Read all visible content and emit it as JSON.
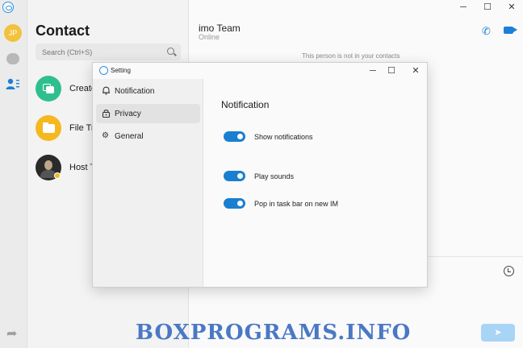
{
  "rail": {
    "avatar_initials": "JP"
  },
  "contacts": {
    "title": "Contact",
    "search_placeholder": "Search (Ctrl+S)",
    "items": [
      {
        "label": "Create",
        "color": "#2fbf8f"
      },
      {
        "label": "File Tr",
        "color": "#f5b820"
      },
      {
        "label": "Host T",
        "color": "#2a2a2a"
      }
    ]
  },
  "chat": {
    "name": "imo Team",
    "status": "Online",
    "notice": "This person is not in your contacts",
    "send_label": "➤"
  },
  "window": {
    "minimize": "─",
    "maximize": "☐",
    "close": "✕"
  },
  "dialog": {
    "title": "Setting",
    "nav": [
      {
        "label": "Notification",
        "icon": "bell-icon"
      },
      {
        "label": "Privacy",
        "icon": "lock-icon",
        "selected": true
      },
      {
        "label": "General",
        "icon": "gear-icon"
      }
    ],
    "heading": "Notification",
    "toggles": [
      {
        "label": "Show notifications",
        "on": true
      },
      {
        "label": "Play sounds",
        "on": true
      },
      {
        "label": "Pop in task bar on new IM",
        "on": true
      }
    ]
  },
  "watermark": "BOXPROGRAMS.INFO",
  "colors": {
    "accent": "#1a7fd0",
    "call_icons": "#1d7fd6"
  }
}
